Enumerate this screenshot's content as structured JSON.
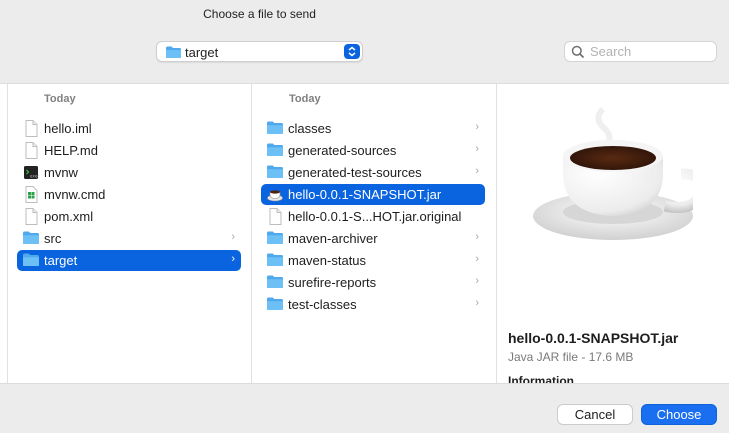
{
  "dialog": {
    "title": "Choose a file to send"
  },
  "toolbar": {
    "location": "target",
    "search_placeholder": "Search"
  },
  "columns": [
    {
      "header": "Today",
      "items": [
        {
          "name": "hello.iml",
          "icon": "document-icon",
          "folder": false,
          "selected": false
        },
        {
          "name": "HELP.md",
          "icon": "document-icon",
          "folder": false,
          "selected": false
        },
        {
          "name": "mvnw",
          "icon": "terminal-exec-icon",
          "folder": false,
          "selected": false
        },
        {
          "name": "mvnw.cmd",
          "icon": "windows-cmd-icon",
          "folder": false,
          "selected": false
        },
        {
          "name": "pom.xml",
          "icon": "document-icon",
          "folder": false,
          "selected": false
        },
        {
          "name": "src",
          "icon": "folder-icon",
          "folder": true,
          "selected": false
        },
        {
          "name": "target",
          "icon": "folder-icon",
          "folder": true,
          "selected": true
        }
      ]
    },
    {
      "header": "Today",
      "items": [
        {
          "name": "classes",
          "icon": "folder-icon",
          "folder": true,
          "selected": false
        },
        {
          "name": "generated-sources",
          "icon": "folder-icon",
          "folder": true,
          "selected": false
        },
        {
          "name": "generated-test-sources",
          "icon": "folder-icon",
          "folder": true,
          "selected": false
        },
        {
          "name": "hello-0.0.1-SNAPSHOT.jar",
          "icon": "java-jar-icon",
          "folder": false,
          "selected": true
        },
        {
          "name": "hello-0.0.1-S...HOT.jar.original",
          "icon": "document-icon",
          "folder": false,
          "selected": false
        },
        {
          "name": "maven-archiver",
          "icon": "folder-icon",
          "folder": true,
          "selected": false
        },
        {
          "name": "maven-status",
          "icon": "folder-icon",
          "folder": true,
          "selected": false
        },
        {
          "name": "surefire-reports",
          "icon": "folder-icon",
          "folder": true,
          "selected": false
        },
        {
          "name": "test-classes",
          "icon": "folder-icon",
          "folder": true,
          "selected": false
        }
      ]
    }
  ],
  "preview": {
    "image": "java-coffee-cup-icon",
    "name": "hello-0.0.1-SNAPSHOT.jar",
    "kind": "Java JAR file - 17.6 MB",
    "info_heading": "Information"
  },
  "buttons": {
    "cancel": "Cancel",
    "choose": "Choose"
  },
  "colors": {
    "accent": "#0a64e0",
    "folder": "#5ab4f0"
  }
}
